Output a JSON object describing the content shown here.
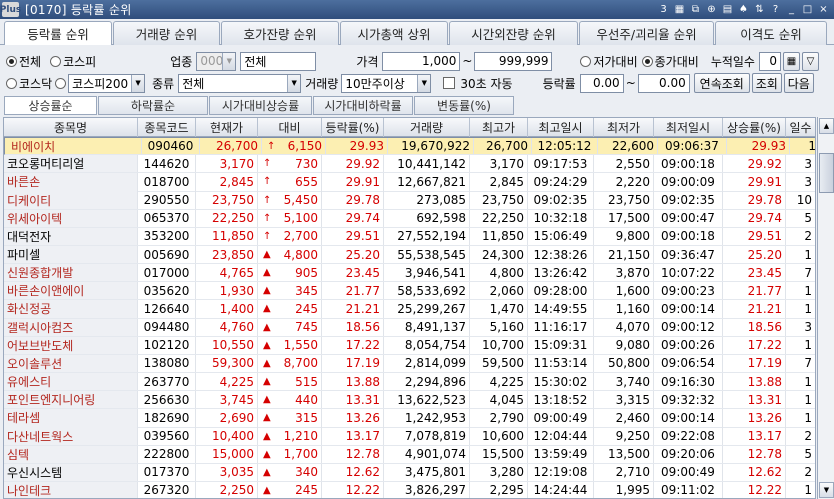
{
  "window": {
    "logo": "Plus",
    "title": "[0170] 등락률 순위",
    "icons": [
      "3-icon",
      "grid-icon",
      "copy-icon",
      "link-icon",
      "chart-icon",
      "pin-icon",
      "layout-icon",
      "help-icon",
      "minimize-icon",
      "maximize-icon",
      "close-icon"
    ],
    "icon_glyphs": [
      "3",
      "▦",
      "⧉",
      "⊕",
      "▤",
      "♠",
      "⇅",
      "?",
      "_",
      "□",
      "×"
    ]
  },
  "tabs": [
    "등락률 순위",
    "거래량 순위",
    "호가잔량 순위",
    "시가총액 상위",
    "시간외잔량 순위",
    "우선주/괴리율 순위",
    "이격도 순위"
  ],
  "filters": {
    "market_all": "전체",
    "market_kospi": "코스피",
    "market_kosdaq": "코스닥",
    "industry_label": "업종",
    "industry_code": "0000",
    "industry_name": "전체",
    "index_select": "코스피200",
    "type_label": "종류",
    "type_select": "전체",
    "price_label": "가격",
    "price_from": "1,000",
    "tilde": "~",
    "price_to": "999,999",
    "volume_label": "거래량",
    "volume_select": "10만주이상",
    "auto30_label": "30초 자동",
    "low_compare": "저가대비",
    "close_compare": "종가대비",
    "change_label": "등락률",
    "change_from": "0.00",
    "change_to": "0.00",
    "cum_days_label": "누적일수",
    "cum_days": "0",
    "btn_continuous": "연속조회",
    "btn_query": "조회",
    "btn_next": "다음"
  },
  "subtabs": [
    "상승률순",
    "하락률순",
    "시가대비상승률",
    "시가대비하락률",
    "변동률(%)"
  ],
  "columns": [
    "종목명",
    "종목코드",
    "현재가",
    "대비",
    "등락률(%)",
    "거래량",
    "최고가",
    "최고일시",
    "최저가",
    "최저일시",
    "상승률(%)",
    "일수"
  ],
  "rows": [
    {
      "name": "비에이치",
      "code": "090460",
      "price": "26,700",
      "dir": "↑",
      "diff": "6,150",
      "rate": "29.93",
      "vol": "19,670,922",
      "high": "26,700",
      "hightime": "12:05:12",
      "low": "22,600",
      "lowtime": "09:06:37",
      "uprate": "29.93",
      "days": "1"
    },
    {
      "name": "코오롱머티리얼",
      "code": "144620",
      "price": "3,170",
      "dir": "↑",
      "diff": "730",
      "rate": "29.92",
      "vol": "10,441,142",
      "high": "3,170",
      "hightime": "09:17:53",
      "low": "2,550",
      "lowtime": "09:00:18",
      "uprate": "29.92",
      "days": "3"
    },
    {
      "name": "바른손",
      "code": "018700",
      "price": "2,845",
      "dir": "↑",
      "diff": "655",
      "rate": "29.91",
      "vol": "12,667,821",
      "high": "2,845",
      "hightime": "09:24:29",
      "low": "2,220",
      "lowtime": "09:00:09",
      "uprate": "29.91",
      "days": "3"
    },
    {
      "name": "디케이티",
      "code": "290550",
      "price": "23,750",
      "dir": "↑",
      "diff": "5,450",
      "rate": "29.78",
      "vol": "273,085",
      "high": "23,750",
      "hightime": "09:02:35",
      "low": "23,750",
      "lowtime": "09:02:35",
      "uprate": "29.78",
      "days": "10"
    },
    {
      "name": "위세아이텍",
      "code": "065370",
      "price": "22,250",
      "dir": "↑",
      "diff": "5,100",
      "rate": "29.74",
      "vol": "692,598",
      "high": "22,250",
      "hightime": "10:32:18",
      "low": "17,500",
      "lowtime": "09:00:47",
      "uprate": "29.74",
      "days": "5"
    },
    {
      "name": "대덕전자",
      "code": "353200",
      "price": "11,850",
      "dir": "↑",
      "diff": "2,700",
      "rate": "29.51",
      "vol": "27,552,194",
      "high": "11,850",
      "hightime": "15:06:49",
      "low": "9,800",
      "lowtime": "09:00:18",
      "uprate": "29.51",
      "days": "2"
    },
    {
      "name": "파미셀",
      "code": "005690",
      "price": "23,850",
      "dir": "▲",
      "diff": "4,800",
      "rate": "25.20",
      "vol": "55,538,545",
      "high": "24,300",
      "hightime": "12:38:26",
      "low": "21,150",
      "lowtime": "09:36:47",
      "uprate": "25.20",
      "days": "1"
    },
    {
      "name": "신원종합개발",
      "code": "017000",
      "price": "4,765",
      "dir": "▲",
      "diff": "905",
      "rate": "23.45",
      "vol": "3,946,541",
      "high": "4,800",
      "hightime": "13:26:42",
      "low": "3,870",
      "lowtime": "10:07:22",
      "uprate": "23.45",
      "days": "7"
    },
    {
      "name": "바른손이앤에이",
      "code": "035620",
      "price": "1,930",
      "dir": "▲",
      "diff": "345",
      "rate": "21.77",
      "vol": "58,533,692",
      "high": "2,060",
      "hightime": "09:28:00",
      "low": "1,600",
      "lowtime": "09:00:23",
      "uprate": "21.77",
      "days": "1"
    },
    {
      "name": "화신정공",
      "code": "126640",
      "price": "1,400",
      "dir": "▲",
      "diff": "245",
      "rate": "21.21",
      "vol": "25,299,267",
      "high": "1,470",
      "hightime": "14:49:55",
      "low": "1,160",
      "lowtime": "09:00:14",
      "uprate": "21.21",
      "days": "1"
    },
    {
      "name": "갤럭시아컴즈",
      "code": "094480",
      "price": "4,760",
      "dir": "▲",
      "diff": "745",
      "rate": "18.56",
      "vol": "8,491,137",
      "high": "5,160",
      "hightime": "11:16:17",
      "low": "4,070",
      "lowtime": "09:00:12",
      "uprate": "18.56",
      "days": "3"
    },
    {
      "name": "어보브반도체",
      "code": "102120",
      "price": "10,550",
      "dir": "▲",
      "diff": "1,550",
      "rate": "17.22",
      "vol": "8,054,754",
      "high": "10,700",
      "hightime": "15:09:31",
      "low": "9,080",
      "lowtime": "09:00:26",
      "uprate": "17.22",
      "days": "1"
    },
    {
      "name": "오이솔루션",
      "code": "138080",
      "price": "59,300",
      "dir": "▲",
      "diff": "8,700",
      "rate": "17.19",
      "vol": "2,814,099",
      "high": "59,500",
      "hightime": "11:53:14",
      "low": "50,800",
      "lowtime": "09:06:54",
      "uprate": "17.19",
      "days": "7"
    },
    {
      "name": "유에스티",
      "code": "263770",
      "price": "4,225",
      "dir": "▲",
      "diff": "515",
      "rate": "13.88",
      "vol": "2,294,896",
      "high": "4,225",
      "hightime": "15:30:02",
      "low": "3,740",
      "lowtime": "09:16:30",
      "uprate": "13.88",
      "days": "1"
    },
    {
      "name": "포인트엔지니어링",
      "code": "256630",
      "price": "3,745",
      "dir": "▲",
      "diff": "440",
      "rate": "13.31",
      "vol": "13,622,523",
      "high": "4,045",
      "hightime": "13:18:52",
      "low": "3,315",
      "lowtime": "09:32:32",
      "uprate": "13.31",
      "days": "1"
    },
    {
      "name": "테라셈",
      "code": "182690",
      "price": "2,690",
      "dir": "▲",
      "diff": "315",
      "rate": "13.26",
      "vol": "1,242,953",
      "high": "2,790",
      "hightime": "09:00:49",
      "low": "2,460",
      "lowtime": "09:00:14",
      "uprate": "13.26",
      "days": "1"
    },
    {
      "name": "다산네트웍스",
      "code": "039560",
      "price": "10,400",
      "dir": "▲",
      "diff": "1,210",
      "rate": "13.17",
      "vol": "7,078,819",
      "high": "10,600",
      "hightime": "12:04:44",
      "low": "9,250",
      "lowtime": "09:22:08",
      "uprate": "13.17",
      "days": "2"
    },
    {
      "name": "심텍",
      "code": "222800",
      "price": "15,000",
      "dir": "▲",
      "diff": "1,700",
      "rate": "12.78",
      "vol": "4,901,074",
      "high": "15,500",
      "hightime": "13:59:49",
      "low": "13,500",
      "lowtime": "09:20:06",
      "uprate": "12.78",
      "days": "5"
    },
    {
      "name": "우신시스템",
      "code": "017370",
      "price": "3,035",
      "dir": "▲",
      "diff": "340",
      "rate": "12.62",
      "vol": "3,475,801",
      "high": "3,280",
      "hightime": "12:19:08",
      "low": "2,710",
      "lowtime": "09:00:49",
      "uprate": "12.62",
      "days": "2"
    },
    {
      "name": "나인테크",
      "code": "267320",
      "price": "2,250",
      "dir": "▲",
      "diff": "245",
      "rate": "12.22",
      "vol": "3,826,297",
      "high": "2,295",
      "hightime": "14:24:44",
      "low": "1,995",
      "lowtime": "09:11:02",
      "uprate": "12.22",
      "days": "1"
    }
  ],
  "colors": {
    "up": "#d50000",
    "selected_row": "#fcefb2",
    "name_colors": [
      "red",
      "black",
      "red",
      "red",
      "red",
      "black",
      "black",
      "red",
      "red",
      "red",
      "red",
      "red",
      "red",
      "red",
      "red",
      "red",
      "red",
      "red",
      "black",
      "red"
    ]
  }
}
